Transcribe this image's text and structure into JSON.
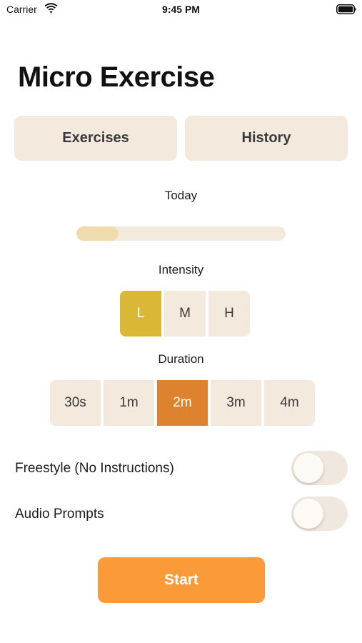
{
  "status_bar": {
    "carrier": "Carrier",
    "time": "9:45 PM",
    "wifi_icon": "wifi-icon",
    "battery_icon": "battery-icon"
  },
  "title": "Micro Exercise",
  "nav": {
    "exercises_label": "Exercises",
    "history_label": "History"
  },
  "today": {
    "label": "Today",
    "progress_fraction": 0.2
  },
  "intensity": {
    "label": "Intensity",
    "options": [
      "L",
      "M",
      "H"
    ],
    "selected": "L",
    "selected_color": "#d8b834"
  },
  "duration": {
    "label": "Duration",
    "options": [
      "30s",
      "1m",
      "2m",
      "3m",
      "4m"
    ],
    "selected": "2m",
    "selected_color": "#dd8330"
  },
  "toggles": {
    "freestyle": {
      "label": "Freestyle (No Instructions)",
      "on": false
    },
    "audio_prompts": {
      "label": "Audio Prompts",
      "on": false
    }
  },
  "start_label": "Start",
  "colors": {
    "segment_bg": "#f3e9dc",
    "start_button": "#fb9a38",
    "progress_fill": "#efdcae"
  }
}
